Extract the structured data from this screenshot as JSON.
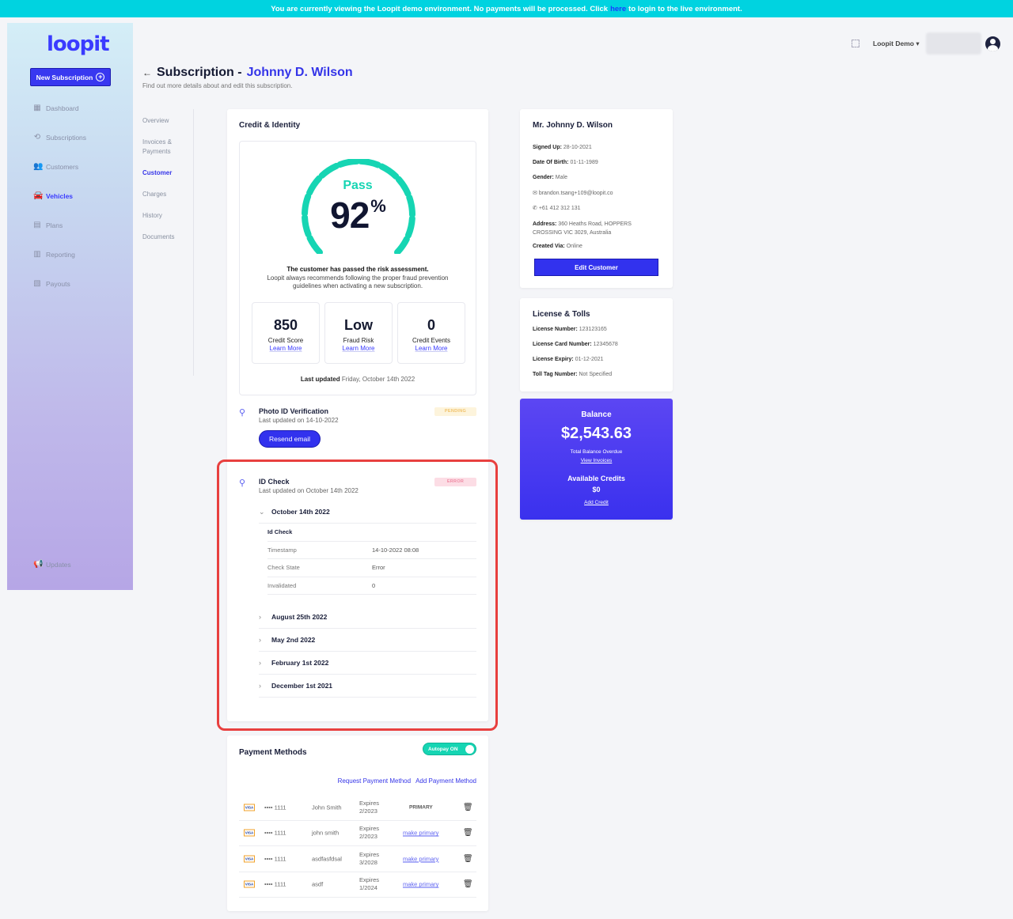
{
  "banner": {
    "before": "You are currently viewing the Loopit demo environment. No payments will be processed. Click",
    "link": "here",
    "after": "to login to the live environment."
  },
  "sidebar": {
    "logo": "loopit",
    "new_subscription": "New Subscription",
    "items": [
      {
        "label": "Dashboard",
        "icon": "dashboard-icon"
      },
      {
        "label": "Subscriptions",
        "icon": "history-icon"
      },
      {
        "label": "Customers",
        "icon": "people-icon"
      },
      {
        "label": "Vehicles",
        "icon": "car-icon"
      },
      {
        "label": "Plans",
        "icon": "document-icon"
      },
      {
        "label": "Reporting",
        "icon": "report-icon"
      },
      {
        "label": "Payouts",
        "icon": "payout-icon"
      }
    ],
    "updates": "Updates"
  },
  "topbar": {
    "account": "Loopit Demo"
  },
  "header": {
    "title": "Subscription -",
    "name": "Johnny D. Wilson",
    "subtitle": "Find out more details about and edit this subscription."
  },
  "subnav": {
    "items": [
      "Overview",
      "Invoices &",
      "Payments",
      "Customer",
      "Charges",
      "History",
      "Documents"
    ]
  },
  "credit": {
    "title": "Credit & Identity",
    "result": "Pass",
    "percent": "92",
    "percent_sign": "%",
    "percent_value": 92,
    "msg_bold": "The customer has passed the risk assessment.",
    "msg": "Loopit always recommends following the proper fraud prevention guidelines when activating a new subscription.",
    "stats": [
      {
        "value": "850",
        "label": "Credit Score",
        "link": "Learn More"
      },
      {
        "value": "Low",
        "label": "Fraud Risk",
        "link": "Learn More"
      },
      {
        "value": "0",
        "label": "Credit Events",
        "link": "Learn More"
      }
    ],
    "last_updated_label": "Last updated",
    "last_updated": "Friday, October 14th 2022"
  },
  "photo_id": {
    "title": "Photo ID Verification",
    "sub": "Last updated on 14-10-2022",
    "badge": "PENDING",
    "button": "Resend email"
  },
  "id_check": {
    "title": "ID Check",
    "sub": "Last updated on October 14th 2022",
    "badge": "ERROR",
    "expanded": "October 14th 2022",
    "rows": [
      {
        "k": "Id Check",
        "v": ""
      },
      {
        "k": "Timestamp",
        "v": "14-10-2022 08:08"
      },
      {
        "k": "Check State",
        "v": "Error"
      },
      {
        "k": "Invalidated",
        "v": "0"
      }
    ],
    "collapsed": [
      "August 25th 2022",
      "May 2nd 2022",
      "February 1st 2022",
      "December 1st 2021"
    ]
  },
  "payment": {
    "title": "Payment Methods",
    "toggle": "Autopay ON",
    "request_link": "Request Payment Method",
    "add_link": "Add Payment Method",
    "rows": [
      {
        "brand": "VISA",
        "num": "•••• 1111",
        "holder": "John Smith",
        "exp1": "Expires",
        "exp2": "2/2023",
        "action": "PRIMARY"
      },
      {
        "brand": "VISA",
        "num": "•••• 1111",
        "holder": "john smith",
        "exp1": "Expires",
        "exp2": "2/2023",
        "action": "make primary"
      },
      {
        "brand": "VISA",
        "num": "•••• 1111",
        "holder": "asdfasfdsal",
        "exp1": "Expires",
        "exp2": "3/2028",
        "action": "make primary"
      },
      {
        "brand": "VISA",
        "num": "•••• 1111",
        "holder": "asdf",
        "exp1": "Expires",
        "exp2": "1/2024",
        "action": "make primary"
      }
    ]
  },
  "profile": {
    "name": "Mr. Johnny D. Wilson",
    "signed_up_label": "Signed Up:",
    "signed_up": "28-10-2021",
    "dob_label": "Date Of Birth:",
    "dob": "01-11-1989",
    "gender_label": "Gender:",
    "gender": "Male",
    "email": "brandon.tsang+109@loopit.co",
    "phone": "+61 412 312 131",
    "address_label": "Address:",
    "address1": "360 Heaths Road, HOPPERS",
    "address2": "CROSSING VIC 3029, Australia",
    "created_label": "Created Via:",
    "created": "Online",
    "edit_button": "Edit Customer"
  },
  "license": {
    "title": "License & Tolls",
    "number_label": "License Number:",
    "number": "123123165",
    "card_label": "License Card Number:",
    "card": "12345678",
    "expiry_label": "License Expiry:",
    "expiry": "01-12-2021",
    "toll_label": "Toll Tag Number:",
    "toll": "Not Specified"
  },
  "balance": {
    "label": "Balance",
    "amount": "$2,543.63",
    "sub": "Total Balance Overdue",
    "view_link": "View Invoices",
    "credits_label": "Available Credits",
    "credits": "$0",
    "add_link": "Add Credit"
  },
  "colors": {
    "accent": "#3434e8",
    "pass": "#16d5b3",
    "error_outline": "#e8403f",
    "banner": "#00d3e0"
  }
}
